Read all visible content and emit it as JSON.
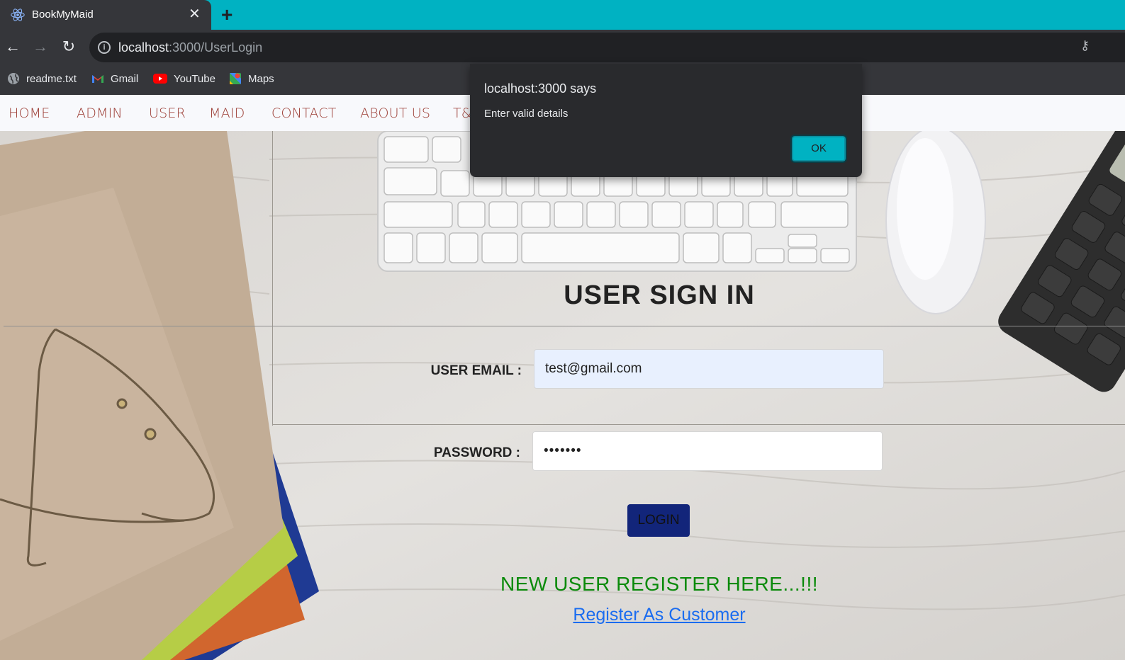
{
  "browser": {
    "tab_title": "BookMyMaid",
    "url_host": "localhost",
    "url_rest": ":3000/UserLogin",
    "bookmarks": [
      "readme.txt",
      "Gmail",
      "YouTube",
      "Maps"
    ]
  },
  "nav": {
    "items": [
      "HOME",
      "ADMIN",
      "USER",
      "MAID",
      "CONTACT",
      "ABOUT US",
      "T&C"
    ]
  },
  "login": {
    "title": "USER SIGN IN",
    "email_label": "USER EMAIL :",
    "email_value": "test@gmail.com",
    "password_label": "PASSWORD :",
    "password_value": "•••••••",
    "login_button": "LOGIN",
    "register_heading": "NEW USER REGISTER HERE...!!!",
    "register_link": "Register As Customer"
  },
  "dialog": {
    "title": "localhost:3000 says",
    "message": "Enter valid details",
    "ok_label": "OK"
  },
  "colors": {
    "tabbar": "#00b2c2",
    "nav_link": "#9b3b33",
    "login_button": "#12257a",
    "register_heading": "#0a8a0a",
    "register_link": "#1a6cf0"
  }
}
